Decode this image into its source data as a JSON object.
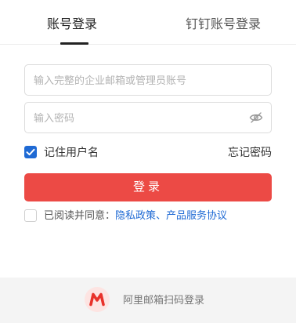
{
  "tabs": {
    "account_login": "账号登录",
    "dingtalk_login": "钉钉账号登录"
  },
  "form": {
    "account_placeholder": "输入完整的企业邮箱或管理员账号",
    "password_placeholder": "输入密码",
    "remember_label": "记住用户名",
    "remember_checked": true,
    "forgot_label": "忘记密码",
    "login_label": "登录",
    "agree_checked": false,
    "agree_prefix": "已阅读并同意：",
    "privacy_link": "隐私政策",
    "separator": "、",
    "service_link": "产品服务协议"
  },
  "footer": {
    "logo": "aliyun-mail-logo",
    "text": "阿里邮箱扫码登录"
  },
  "colors": {
    "accent_red": "#ec4a45",
    "link_blue": "#1f6ad4"
  }
}
